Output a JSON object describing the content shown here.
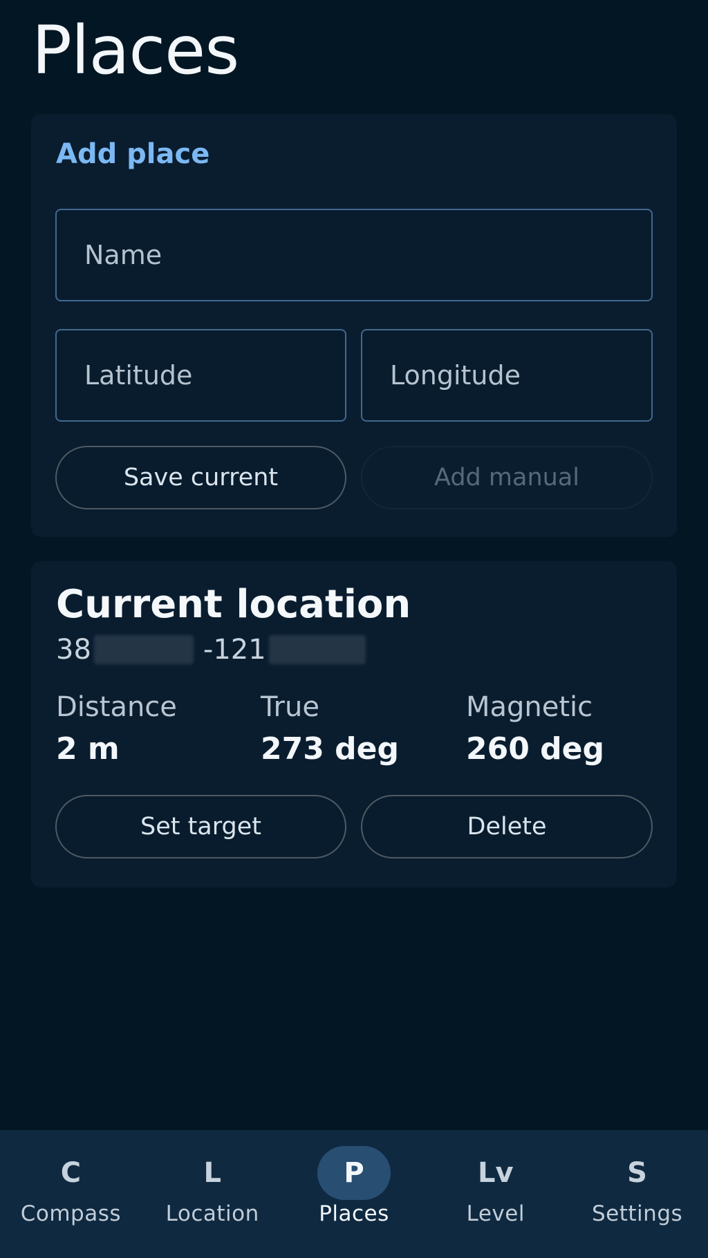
{
  "header": {
    "title": "Places"
  },
  "add_place": {
    "title": "Add place",
    "name_placeholder": "Name",
    "latitude_placeholder": "Latitude",
    "longitude_placeholder": "Longitude",
    "save_current_label": "Save current",
    "add_manual_label": "Add manual"
  },
  "place": {
    "name": "Current location",
    "lat_prefix": "38",
    "lon_prefix": "-121",
    "stats": {
      "distance_label": "Distance",
      "distance_value": "2 m",
      "true_label": "True",
      "true_value": "273 deg",
      "magnetic_label": "Magnetic",
      "magnetic_value": "260 deg"
    },
    "set_target_label": "Set target",
    "delete_label": "Delete"
  },
  "nav": {
    "items": [
      {
        "icon": "C",
        "label": "Compass"
      },
      {
        "icon": "L",
        "label": "Location"
      },
      {
        "icon": "P",
        "label": "Places"
      },
      {
        "icon": "Lv",
        "label": "Level"
      },
      {
        "icon": "S",
        "label": "Settings"
      }
    ],
    "active_index": 2
  },
  "colors": {
    "background": "#031624",
    "card": "#0a1d2f",
    "accent": "#7cb9f3",
    "field_border": "#42698f",
    "nav_background": "#0f2940",
    "nav_active_pill": "#284e72"
  }
}
